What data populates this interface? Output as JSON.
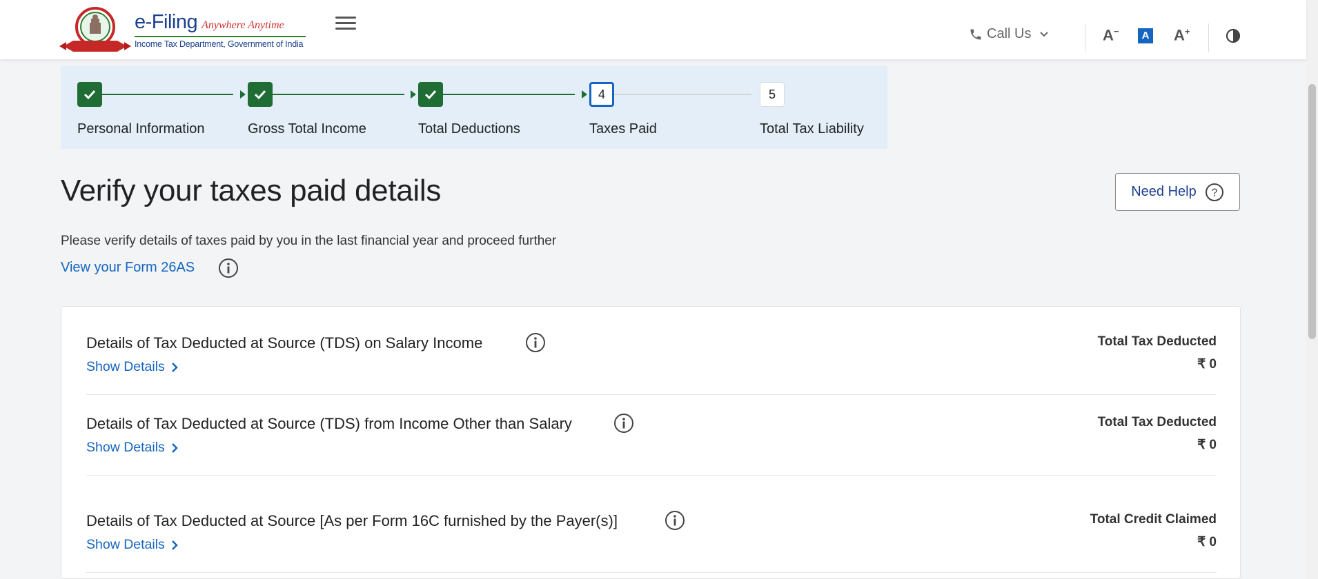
{
  "header": {
    "brand_name": "e-Filing",
    "brand_tagline": "Anywhere Anytime",
    "brand_subtitle": "Income Tax Department, Government of India",
    "call_us_label": "Call Us",
    "font_decrease": "A",
    "font_default": "A",
    "font_increase": "A",
    "accent_color": "#1565c0",
    "brand_color": "#1b3f8f"
  },
  "stepper": {
    "steps": [
      {
        "label": "Personal Information",
        "number": "1",
        "status": "completed"
      },
      {
        "label": "Gross Total Income",
        "number": "2",
        "status": "completed"
      },
      {
        "label": "Total Deductions",
        "number": "3",
        "status": "completed"
      },
      {
        "label": "Taxes Paid",
        "number": "4",
        "status": "current"
      },
      {
        "label": "Total Tax Liability",
        "number": "5",
        "status": "pending"
      }
    ],
    "completed_color": "#1f6d35"
  },
  "main": {
    "title": "Verify your taxes paid details",
    "need_help_label": "Need Help",
    "subtitle": "Please verify details of taxes paid by you in the last financial year and proceed further",
    "form26as_link": "View your Form 26AS",
    "sections": [
      {
        "title": "Details of Tax Deducted at Source (TDS) on Salary Income",
        "show_details": "Show Details",
        "total_label": "Total Tax Deducted",
        "total_value": "₹ 0"
      },
      {
        "title": "Details of Tax Deducted at Source (TDS) from Income Other than Salary",
        "show_details": "Show Details",
        "total_label": "Total Tax Deducted",
        "total_value": "₹ 0"
      },
      {
        "title": "Details of Tax Deducted at Source [As per Form 16C furnished by the Payer(s)]",
        "show_details": "Show Details",
        "total_label": "Total Credit Claimed",
        "total_value": "₹ 0"
      }
    ]
  }
}
